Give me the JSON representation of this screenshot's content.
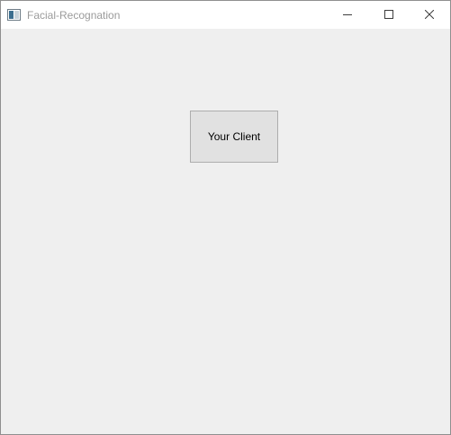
{
  "window": {
    "title": "Facial-Recognation",
    "controls": {
      "minimize": "minimize-icon",
      "maximize": "maximize-icon",
      "close": "close-icon"
    }
  },
  "main": {
    "client_button_label": "Your Client"
  },
  "colors": {
    "titlebar_bg": "#ffffff",
    "client_bg": "#efefef",
    "title_text": "#9b9b9b",
    "button_bg": "#e1e1e1",
    "button_border": "#adadad"
  }
}
